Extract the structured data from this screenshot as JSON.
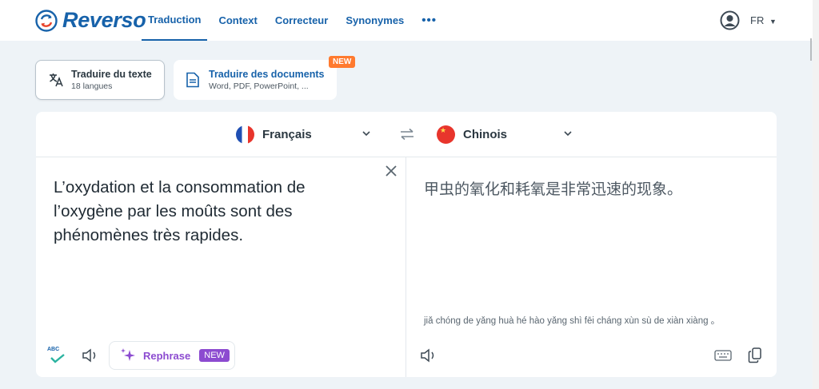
{
  "header": {
    "logo_text": "Reverso",
    "nav": [
      {
        "label": "Traduction",
        "active": true
      },
      {
        "label": "Context"
      },
      {
        "label": "Correcteur"
      },
      {
        "label": "Synonymes"
      }
    ],
    "more_label": "•••",
    "ui_language": "FR",
    "brand_color": "#1762aa"
  },
  "modes": {
    "text": {
      "title": "Traduire du texte",
      "subtitle": "18 langues"
    },
    "documents": {
      "title": "Traduire des documents",
      "subtitle": "Word, PDF, PowerPoint, ...",
      "badge": "NEW"
    }
  },
  "translator": {
    "source_lang": "Français",
    "target_lang": "Chinois",
    "source_text": "L’oxydation et la consommation de l’oxygène par les moûts sont des phénomènes très rapides.",
    "target_text": "甲虫的氧化和耗氧是非常迅速的现象。",
    "pinyin": "jiǎ chóng de yǎng huà hé hào yǎng shì fēi cháng xùn sù de xiàn xiàng 。",
    "spellcheck_label": "ABC",
    "rephrase": {
      "label": "Rephrase",
      "badge": "NEW",
      "accent": "#8c4bd0"
    }
  }
}
